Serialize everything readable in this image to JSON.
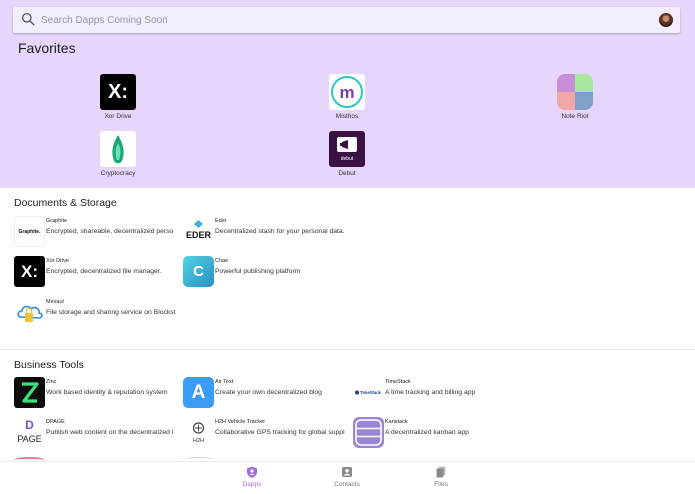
{
  "search": {
    "placeholder": "Search Dapps Coming Soon"
  },
  "favorites": {
    "title": "Favorites",
    "items": [
      {
        "label": "Xor Drive"
      },
      {
        "label": "Misthos"
      },
      {
        "label": "Note Riot"
      },
      {
        "label": "Cryptocracy"
      },
      {
        "label": "Debut"
      }
    ]
  },
  "sections": [
    {
      "title": "Documents & Storage",
      "apps": [
        {
          "name": "Graphite",
          "desc": "Encrypted, shareable, decentralized perso"
        },
        {
          "name": "Eder",
          "desc": "Decentralized stash for your personal data."
        },
        {
          "name": "Xor Drive",
          "desc": "Encrypted, decentralized file manager."
        },
        {
          "name": "Chae",
          "desc": "Powerful publishing platform"
        },
        {
          "name": "Mevaul",
          "desc": "File storage and sharing service on Blockst"
        }
      ]
    },
    {
      "title": "Business Tools",
      "apps": [
        {
          "name": "Zinc",
          "desc": "Work based identity & reputation system"
        },
        {
          "name": "Air Text",
          "desc": "Create your own decentralized blog"
        },
        {
          "name": "TimeStack",
          "desc": "A time tracking and billing app"
        },
        {
          "name": "DPAGE",
          "desc": "Publish web content on the decentralized i"
        },
        {
          "name": "H2H Vehicle Tracker",
          "desc": "Collaborative GPS tracking for global suppl"
        },
        {
          "name": "Kanstack",
          "desc": "A decentralized kanban app"
        }
      ]
    }
  ],
  "icon_text": {
    "xor": "X:",
    "graphite": "Graphite.",
    "eder": "EDER",
    "chae": "C",
    "airtext": "A",
    "timestack": "TimeStack",
    "dpage_letter": "D",
    "dpage_word": "PAGE",
    "h2h": "H2H",
    "debut": "debut"
  },
  "nav": [
    {
      "label": "Dapps",
      "active": true
    },
    {
      "label": "Contacts",
      "active": false
    },
    {
      "label": "Files",
      "active": false
    }
  ],
  "colors": {
    "header_bg": "#e6d6fb",
    "accent": "#a06ce0"
  }
}
